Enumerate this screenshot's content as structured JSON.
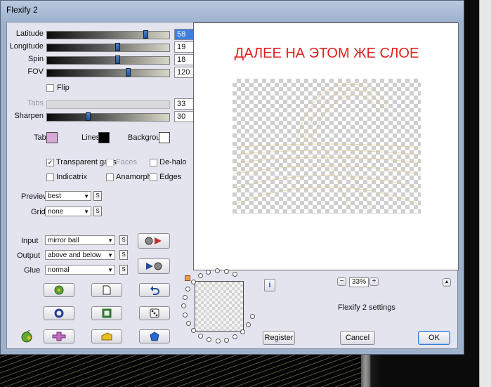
{
  "window": {
    "title": "Flexify 2"
  },
  "sliders": [
    {
      "label": "Latitude",
      "value": "58",
      "level": 0.82,
      "selected": true,
      "disabled": false
    },
    {
      "label": "Longitude",
      "value": "19",
      "level": 0.58,
      "selected": false,
      "disabled": false
    },
    {
      "label": "Spin",
      "value": "18",
      "level": 0.58,
      "selected": false,
      "disabled": false
    },
    {
      "label": "FOV",
      "value": "120",
      "level": 0.67,
      "selected": false,
      "disabled": false
    }
  ],
  "flip": {
    "label": "Flip",
    "checked": false
  },
  "tabs_slider": {
    "label": "Tabs",
    "value": "33",
    "disabled": true
  },
  "sharpen_slider": {
    "label": "Sharpen",
    "value": "30",
    "level": 0.33
  },
  "colors": {
    "tab": {
      "label": "Tab",
      "color": "#d9a8d9"
    },
    "lines": {
      "label": "Lines",
      "color": "#000000"
    },
    "background": {
      "label": "Background",
      "color": "#ffffff"
    }
  },
  "options": [
    {
      "label": "Transparent gaps",
      "checked": true,
      "disabled": false
    },
    {
      "label": "Faces",
      "checked": false,
      "disabled": true
    },
    {
      "label": "De-halo",
      "checked": false,
      "disabled": false
    },
    {
      "label": "Indicatrix",
      "checked": false,
      "disabled": false
    },
    {
      "label": "Anamorph",
      "checked": false,
      "disabled": false
    },
    {
      "label": "Edges",
      "checked": false,
      "disabled": false
    }
  ],
  "preview_mode": {
    "label": "Preview",
    "value": "best"
  },
  "grid": {
    "label": "Grid",
    "value": "none"
  },
  "input": {
    "label": "Input",
    "value": "mirror ball"
  },
  "output": {
    "label": "Output",
    "value": "above and below"
  },
  "glue": {
    "label": "Glue",
    "value": "normal"
  },
  "s_label": "S",
  "preview": {
    "text": "ДАЛЕЕ НА ЭТОМ ЖЕ СЛОЕ"
  },
  "zoom": {
    "minus": "−",
    "value": "33%",
    "plus": "+"
  },
  "settings_caption": "Flexify 2 settings",
  "buttons": {
    "register": "Register",
    "cancel": "Cancel",
    "ok": "OK",
    "info": "i",
    "collapse": "▲"
  },
  "icons": {
    "play_forward": "play-forward-icon",
    "play_back": "play-back-icon",
    "random": "random-icon",
    "new_doc": "new-document-icon",
    "undo": "undo-icon",
    "ring": "ring-icon",
    "square": "square-icon",
    "dice": "dice-icon",
    "puzzle": "puzzle-icon",
    "cheese": "cheese-icon",
    "pentagon": "pentagon-icon",
    "apple": "apple-icon"
  },
  "accent": "#1f4f9c"
}
